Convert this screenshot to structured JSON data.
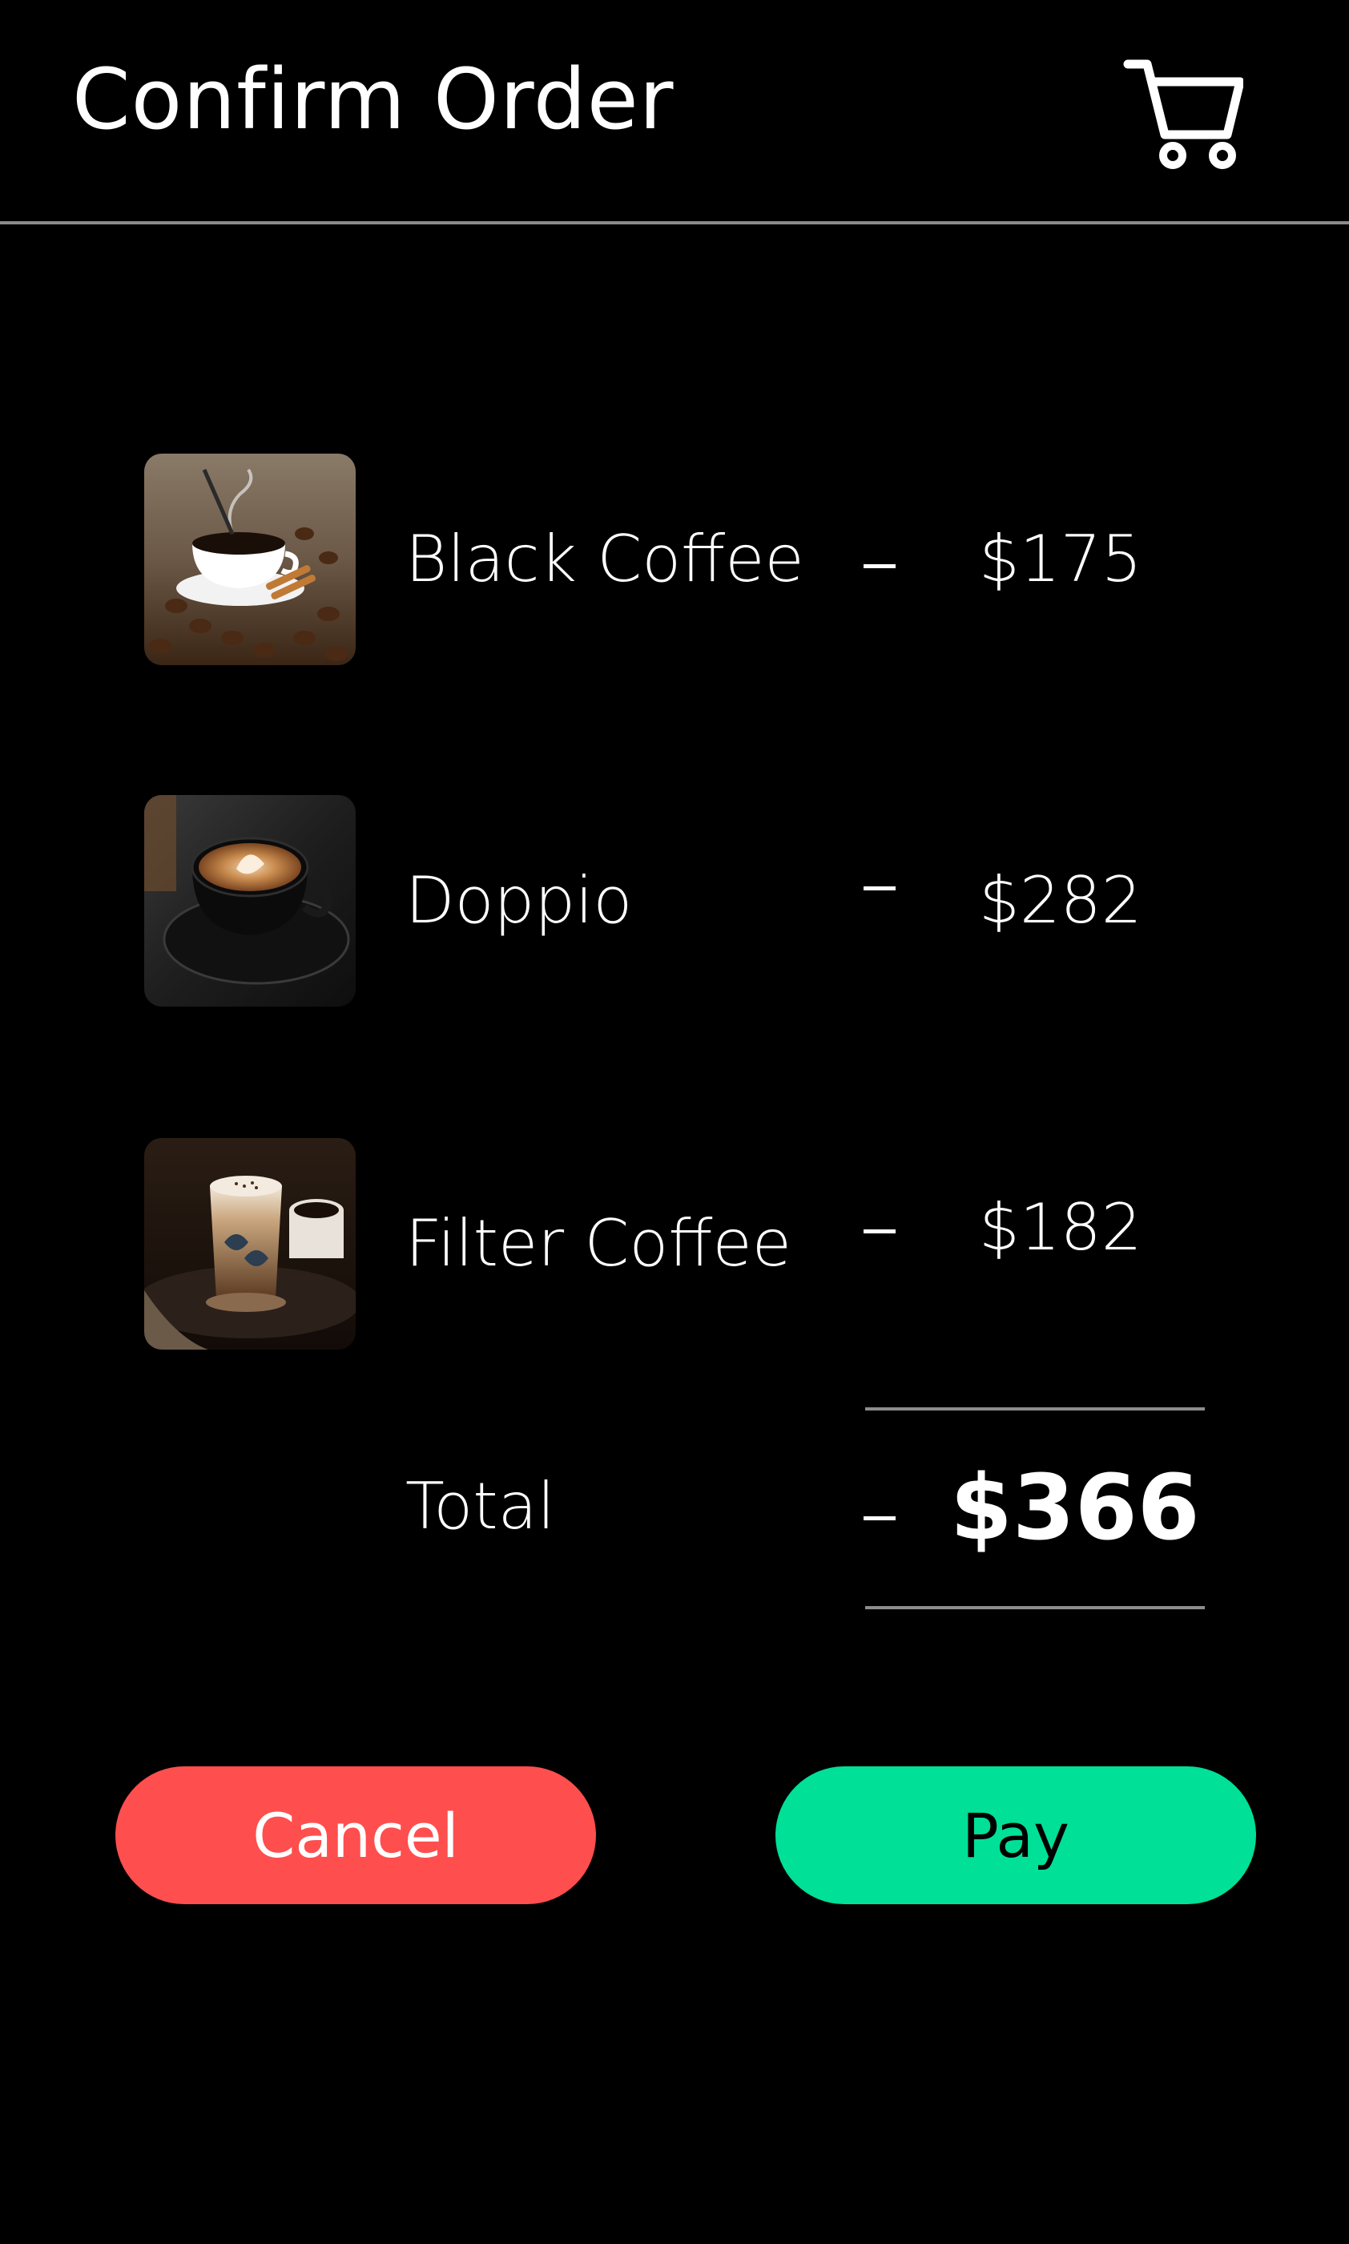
{
  "header": {
    "title": "Confirm Order",
    "cart_icon": "shopping-cart-icon"
  },
  "order": {
    "items": [
      {
        "name": "Black Coffee",
        "price": "$175",
        "image": "black-coffee-image"
      },
      {
        "name": "Doppio",
        "price": "$282",
        "image": "doppio-image"
      },
      {
        "name": "Filter Coffee",
        "price": "$182",
        "image": "filter-coffee-image"
      }
    ],
    "total_label": "Total",
    "total_value": "$366"
  },
  "actions": {
    "cancel_label": "Cancel",
    "pay_label": "Pay"
  },
  "colors": {
    "background": "#000000",
    "cancel": "#ff4e4e",
    "pay": "#00e096",
    "divider": "#8c8c8c"
  }
}
